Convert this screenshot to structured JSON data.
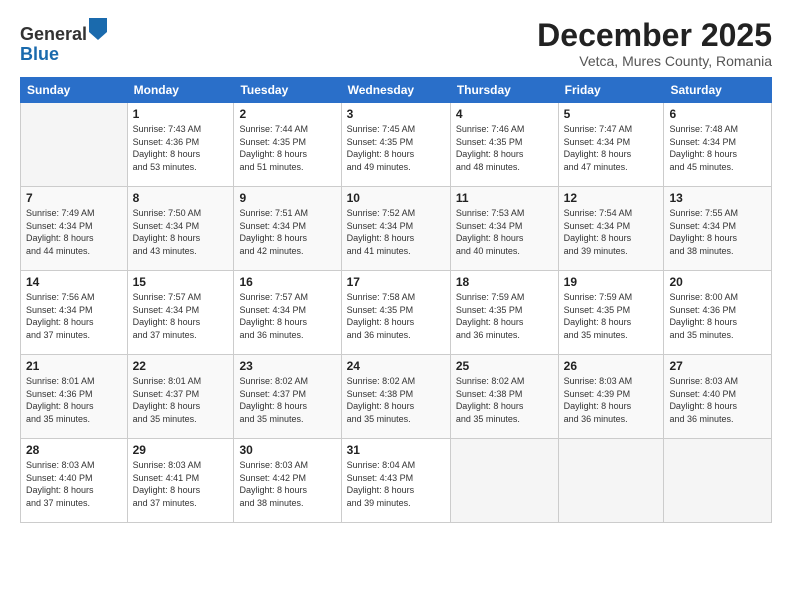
{
  "header": {
    "logo": {
      "line1": "General",
      "line2": "Blue"
    },
    "title": "December 2025",
    "location": "Vetca, Mures County, Romania"
  },
  "weekdays": [
    "Sunday",
    "Monday",
    "Tuesday",
    "Wednesday",
    "Thursday",
    "Friday",
    "Saturday"
  ],
  "weeks": [
    [
      {
        "day": "",
        "empty": true
      },
      {
        "day": "1",
        "sunrise": "Sunrise: 7:43 AM",
        "sunset": "Sunset: 4:36 PM",
        "daylight": "Daylight: 8 hours and 53 minutes."
      },
      {
        "day": "2",
        "sunrise": "Sunrise: 7:44 AM",
        "sunset": "Sunset: 4:35 PM",
        "daylight": "Daylight: 8 hours and 51 minutes."
      },
      {
        "day": "3",
        "sunrise": "Sunrise: 7:45 AM",
        "sunset": "Sunset: 4:35 PM",
        "daylight": "Daylight: 8 hours and 49 minutes."
      },
      {
        "day": "4",
        "sunrise": "Sunrise: 7:46 AM",
        "sunset": "Sunset: 4:35 PM",
        "daylight": "Daylight: 8 hours and 48 minutes."
      },
      {
        "day": "5",
        "sunrise": "Sunrise: 7:47 AM",
        "sunset": "Sunset: 4:34 PM",
        "daylight": "Daylight: 8 hours and 47 minutes."
      },
      {
        "day": "6",
        "sunrise": "Sunrise: 7:48 AM",
        "sunset": "Sunset: 4:34 PM",
        "daylight": "Daylight: 8 hours and 45 minutes."
      }
    ],
    [
      {
        "day": "7",
        "sunrise": "Sunrise: 7:49 AM",
        "sunset": "Sunset: 4:34 PM",
        "daylight": "Daylight: 8 hours and 44 minutes."
      },
      {
        "day": "8",
        "sunrise": "Sunrise: 7:50 AM",
        "sunset": "Sunset: 4:34 PM",
        "daylight": "Daylight: 8 hours and 43 minutes."
      },
      {
        "day": "9",
        "sunrise": "Sunrise: 7:51 AM",
        "sunset": "Sunset: 4:34 PM",
        "daylight": "Daylight: 8 hours and 42 minutes."
      },
      {
        "day": "10",
        "sunrise": "Sunrise: 7:52 AM",
        "sunset": "Sunset: 4:34 PM",
        "daylight": "Daylight: 8 hours and 41 minutes."
      },
      {
        "day": "11",
        "sunrise": "Sunrise: 7:53 AM",
        "sunset": "Sunset: 4:34 PM",
        "daylight": "Daylight: 8 hours and 40 minutes."
      },
      {
        "day": "12",
        "sunrise": "Sunrise: 7:54 AM",
        "sunset": "Sunset: 4:34 PM",
        "daylight": "Daylight: 8 hours and 39 minutes."
      },
      {
        "day": "13",
        "sunrise": "Sunrise: 7:55 AM",
        "sunset": "Sunset: 4:34 PM",
        "daylight": "Daylight: 8 hours and 38 minutes."
      }
    ],
    [
      {
        "day": "14",
        "sunrise": "Sunrise: 7:56 AM",
        "sunset": "Sunset: 4:34 PM",
        "daylight": "Daylight: 8 hours and 37 minutes."
      },
      {
        "day": "15",
        "sunrise": "Sunrise: 7:57 AM",
        "sunset": "Sunset: 4:34 PM",
        "daylight": "Daylight: 8 hours and 37 minutes."
      },
      {
        "day": "16",
        "sunrise": "Sunrise: 7:57 AM",
        "sunset": "Sunset: 4:34 PM",
        "daylight": "Daylight: 8 hours and 36 minutes."
      },
      {
        "day": "17",
        "sunrise": "Sunrise: 7:58 AM",
        "sunset": "Sunset: 4:35 PM",
        "daylight": "Daylight: 8 hours and 36 minutes."
      },
      {
        "day": "18",
        "sunrise": "Sunrise: 7:59 AM",
        "sunset": "Sunset: 4:35 PM",
        "daylight": "Daylight: 8 hours and 36 minutes."
      },
      {
        "day": "19",
        "sunrise": "Sunrise: 7:59 AM",
        "sunset": "Sunset: 4:35 PM",
        "daylight": "Daylight: 8 hours and 35 minutes."
      },
      {
        "day": "20",
        "sunrise": "Sunrise: 8:00 AM",
        "sunset": "Sunset: 4:36 PM",
        "daylight": "Daylight: 8 hours and 35 minutes."
      }
    ],
    [
      {
        "day": "21",
        "sunrise": "Sunrise: 8:01 AM",
        "sunset": "Sunset: 4:36 PM",
        "daylight": "Daylight: 8 hours and 35 minutes."
      },
      {
        "day": "22",
        "sunrise": "Sunrise: 8:01 AM",
        "sunset": "Sunset: 4:37 PM",
        "daylight": "Daylight: 8 hours and 35 minutes."
      },
      {
        "day": "23",
        "sunrise": "Sunrise: 8:02 AM",
        "sunset": "Sunset: 4:37 PM",
        "daylight": "Daylight: 8 hours and 35 minutes."
      },
      {
        "day": "24",
        "sunrise": "Sunrise: 8:02 AM",
        "sunset": "Sunset: 4:38 PM",
        "daylight": "Daylight: 8 hours and 35 minutes."
      },
      {
        "day": "25",
        "sunrise": "Sunrise: 8:02 AM",
        "sunset": "Sunset: 4:38 PM",
        "daylight": "Daylight: 8 hours and 35 minutes."
      },
      {
        "day": "26",
        "sunrise": "Sunrise: 8:03 AM",
        "sunset": "Sunset: 4:39 PM",
        "daylight": "Daylight: 8 hours and 36 minutes."
      },
      {
        "day": "27",
        "sunrise": "Sunrise: 8:03 AM",
        "sunset": "Sunset: 4:40 PM",
        "daylight": "Daylight: 8 hours and 36 minutes."
      }
    ],
    [
      {
        "day": "28",
        "sunrise": "Sunrise: 8:03 AM",
        "sunset": "Sunset: 4:40 PM",
        "daylight": "Daylight: 8 hours and 37 minutes."
      },
      {
        "day": "29",
        "sunrise": "Sunrise: 8:03 AM",
        "sunset": "Sunset: 4:41 PM",
        "daylight": "Daylight: 8 hours and 37 minutes."
      },
      {
        "day": "30",
        "sunrise": "Sunrise: 8:03 AM",
        "sunset": "Sunset: 4:42 PM",
        "daylight": "Daylight: 8 hours and 38 minutes."
      },
      {
        "day": "31",
        "sunrise": "Sunrise: 8:04 AM",
        "sunset": "Sunset: 4:43 PM",
        "daylight": "Daylight: 8 hours and 39 minutes."
      },
      {
        "day": "",
        "empty": true
      },
      {
        "day": "",
        "empty": true
      },
      {
        "day": "",
        "empty": true
      }
    ]
  ]
}
